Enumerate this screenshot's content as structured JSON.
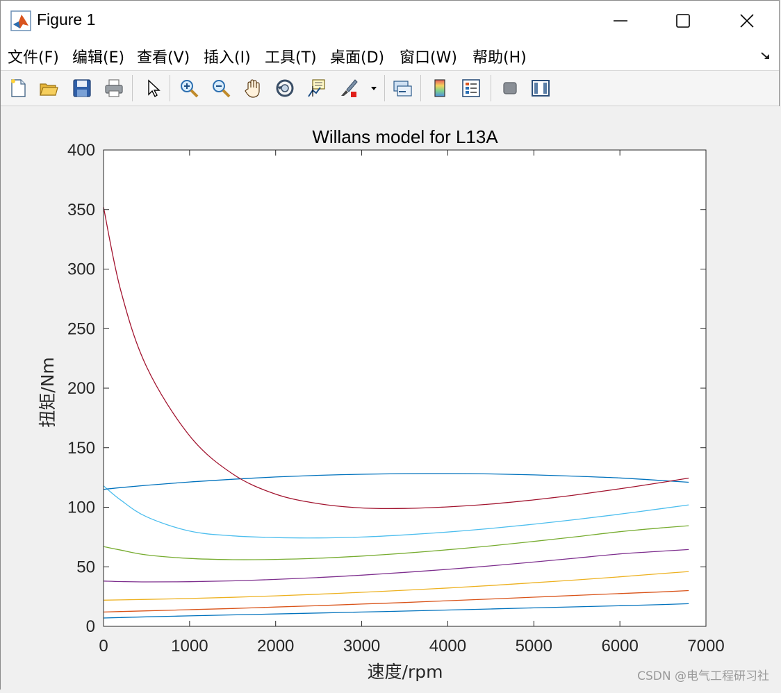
{
  "window": {
    "title": "Figure 1"
  },
  "menu": {
    "items": [
      {
        "label": "文件(F)"
      },
      {
        "label": "编辑(E)"
      },
      {
        "label": "查看(V)"
      },
      {
        "label": "插入(I)"
      },
      {
        "label": "工具(T)"
      },
      {
        "label": "桌面(D)"
      },
      {
        "label": "窗口(W)"
      },
      {
        "label": "帮助(H)"
      }
    ]
  },
  "toolbar": {
    "icons": [
      "new-figure-icon",
      "open-file-icon",
      "save-icon",
      "print-icon",
      "pointer-icon",
      "zoom-in-icon",
      "zoom-out-icon",
      "pan-icon",
      "rotate-3d-icon",
      "data-cursor-icon",
      "brush-icon",
      "link-icon",
      "colorbar-icon",
      "legend-icon",
      "hide-plot-tools-icon",
      "show-plot-tools-icon"
    ]
  },
  "watermark": "CSDN @电气工程研习社",
  "chart_data": {
    "type": "line",
    "title": "Willans model for L13A",
    "xlabel": "速度/rpm",
    "ylabel": "扭矩/Nm",
    "xlim": [
      0,
      7000
    ],
    "ylim": [
      0,
      400
    ],
    "xticks": [
      0,
      1000,
      2000,
      3000,
      4000,
      5000,
      6000,
      7000
    ],
    "yticks": [
      0,
      50,
      100,
      150,
      200,
      250,
      300,
      350,
      400
    ],
    "grid": false,
    "x": [
      0,
      200,
      500,
      1000,
      1500,
      2000,
      2500,
      3000,
      3500,
      4000,
      4500,
      5000,
      5500,
      6000,
      6500,
      6800
    ],
    "series": [
      {
        "color": "#0072BD",
        "values": [
          7,
          7.4,
          8,
          8.8,
          9.6,
          10.4,
          11.2,
          12,
          12.8,
          13.7,
          14.6,
          15.5,
          16.4,
          17.3,
          18.3,
          19
        ]
      },
      {
        "color": "#D95319",
        "values": [
          12,
          12.4,
          13,
          14,
          15,
          16.2,
          17.4,
          18.7,
          20,
          21.5,
          23,
          24.5,
          26,
          27.5,
          29,
          30
        ]
      },
      {
        "color": "#EDB120",
        "values": [
          22,
          22.2,
          22.6,
          23.4,
          24.4,
          25.6,
          27,
          28.6,
          30.3,
          32.2,
          34.3,
          36.6,
          39,
          41.6,
          44.4,
          46
        ]
      },
      {
        "color": "#7E2F8E",
        "values": [
          38,
          37.6,
          37.3,
          37.5,
          38.2,
          39.4,
          41,
          43,
          45.3,
          47.9,
          50.8,
          54,
          57.4,
          60.8,
          63.2,
          64.5
        ]
      },
      {
        "color": "#77AC30",
        "values": [
          67,
          64,
          60,
          57,
          56,
          56.2,
          57.2,
          59,
          61.4,
          64.3,
          67.6,
          71.3,
          75.3,
          79.5,
          82.8,
          84.5
        ]
      },
      {
        "color": "#4DBEEE",
        "values": [
          118,
          106,
          92,
          80,
          76,
          74.5,
          74.2,
          75,
          76.8,
          79.2,
          82.2,
          85.8,
          89.8,
          94.2,
          99,
          102
        ]
      },
      {
        "color": "#0072BD",
        "values": [
          115,
          116.5,
          118.4,
          121.2,
          123.5,
          125.4,
          126.8,
          127.7,
          128.2,
          128.3,
          128,
          127.2,
          126,
          124.6,
          122.4,
          121
        ]
      },
      {
        "color": "#A2142F",
        "values": [
          352,
          282,
          218,
          160,
          128,
          111,
          103,
          99.4,
          99,
          100.3,
          102.7,
          106.2,
          110.5,
          115.5,
          121,
          124.5
        ]
      }
    ]
  }
}
